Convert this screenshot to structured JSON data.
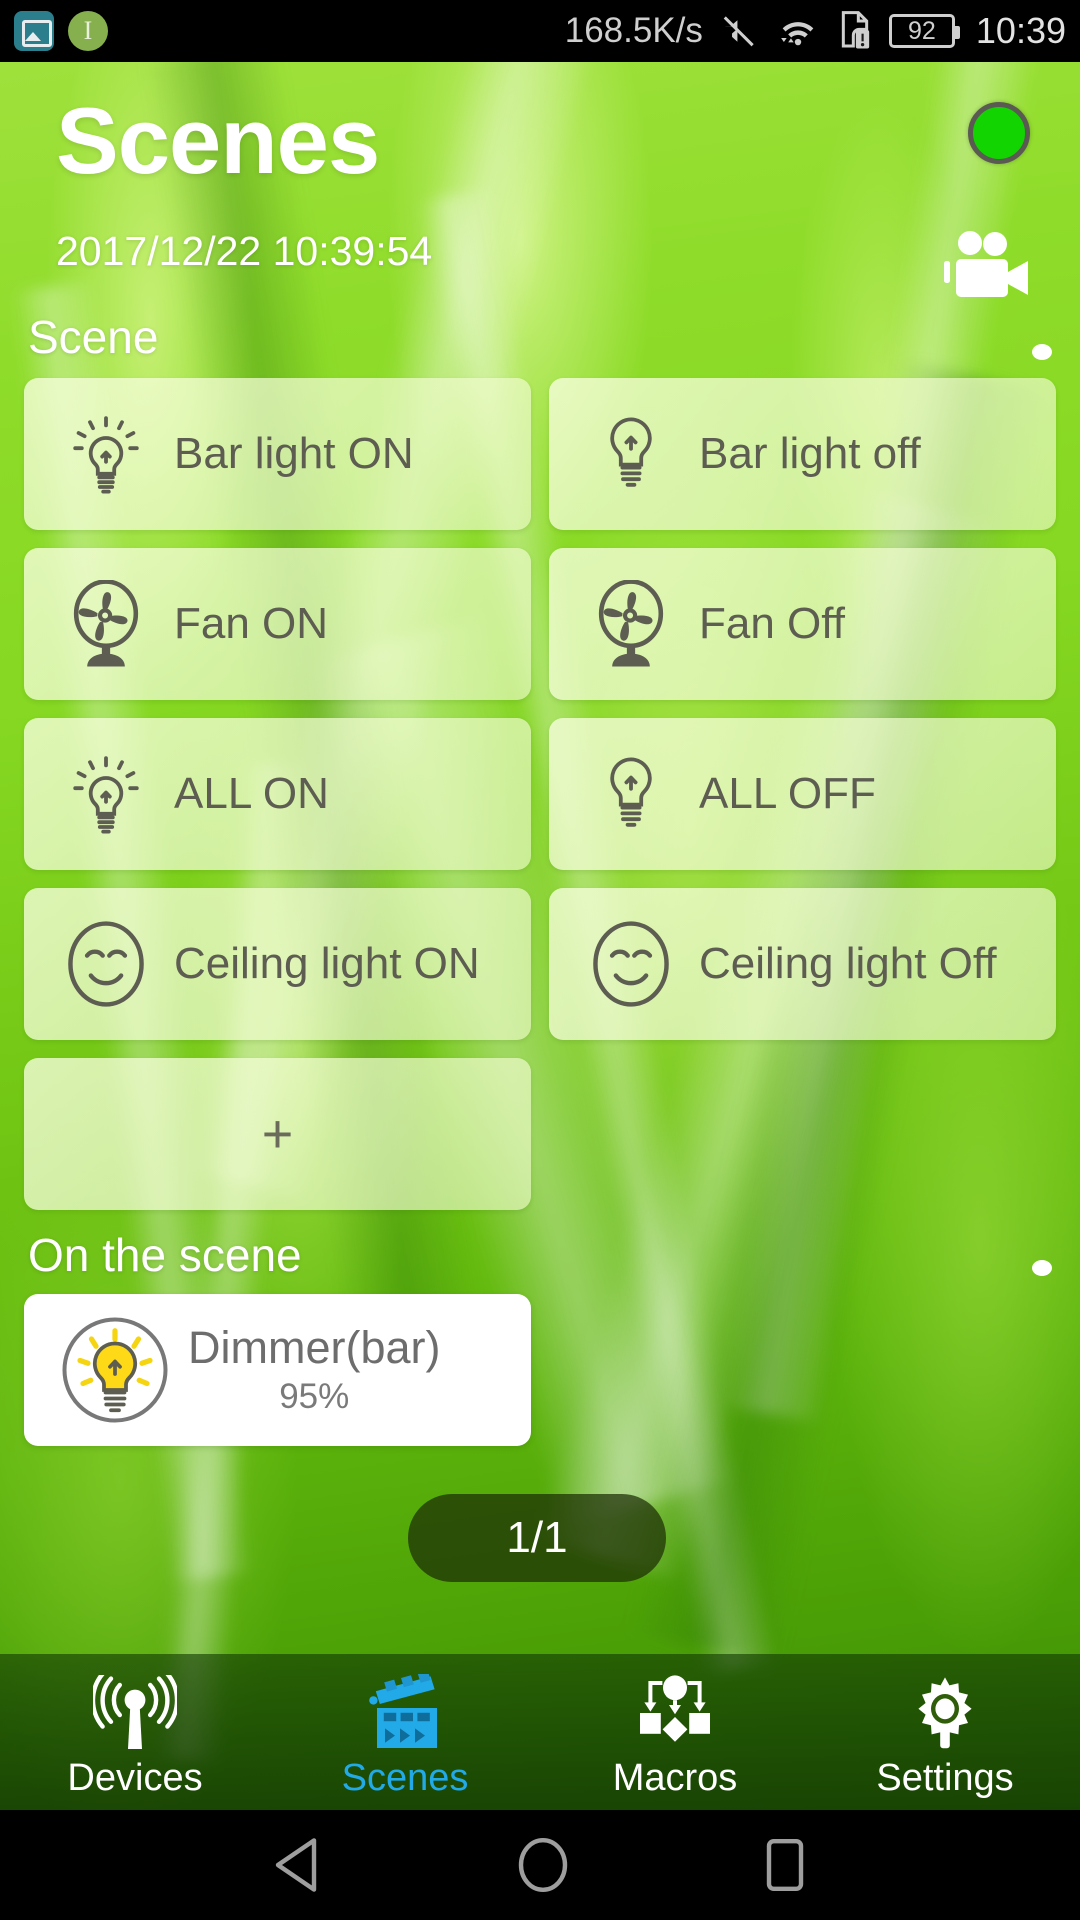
{
  "statusbar": {
    "left_icons": [
      {
        "name": "gallery-icon",
        "glyph": ""
      },
      {
        "name": "info-icon",
        "glyph": "I"
      }
    ],
    "network_speed": "168.5K/s",
    "mute_icon": "mute-icon",
    "wifi_icon": "wifi-icon",
    "sim_alert_icon": "sim-card-alert-icon",
    "battery_level": "92",
    "clock": "10:39"
  },
  "header": {
    "title": "Scenes",
    "datetime": "2017/12/22 10:39:54",
    "status_led": {
      "name": "connection-status-led",
      "color": "#12d400"
    },
    "camcorder_icon": "camcorder-icon"
  },
  "sections": {
    "scene_label": "Scene",
    "on_the_scene_label": "On the scene"
  },
  "scenes": [
    {
      "label": "Bar light ON",
      "icon": "bulb-on-icon"
    },
    {
      "label": "Bar light off",
      "icon": "bulb-off-icon"
    },
    {
      "label": "Fan ON",
      "icon": "fan-icon"
    },
    {
      "label": "Fan Off",
      "icon": "fan-icon"
    },
    {
      "label": "ALL ON",
      "icon": "bulb-on-icon"
    },
    {
      "label": "ALL OFF",
      "icon": "bulb-off-icon"
    },
    {
      "label": "Ceiling light ON",
      "icon": "smiley-icon"
    },
    {
      "label": "Ceiling light Off",
      "icon": "smiley-icon"
    }
  ],
  "add_scene": {
    "label": "+",
    "icon": "plus-icon"
  },
  "on_the_scene": {
    "device_name": "Dimmer(bar)",
    "device_value": "95%",
    "icon": "dimmer-bulb-icon"
  },
  "pagination": {
    "label": "1/1"
  },
  "bottom_nav": {
    "active_color": "#22a9e8",
    "items": [
      {
        "label": "Devices",
        "icon": "antenna-signal-icon",
        "active": false
      },
      {
        "label": "Scenes",
        "icon": "clapperboard-icon",
        "active": true
      },
      {
        "label": "Macros",
        "icon": "flowchart-icon",
        "active": false
      },
      {
        "label": "Settings",
        "icon": "gear-icon",
        "active": false
      }
    ]
  },
  "android_nav": {
    "back": "back-triangle-icon",
    "home": "home-circle-icon",
    "recents": "recents-square-icon"
  }
}
